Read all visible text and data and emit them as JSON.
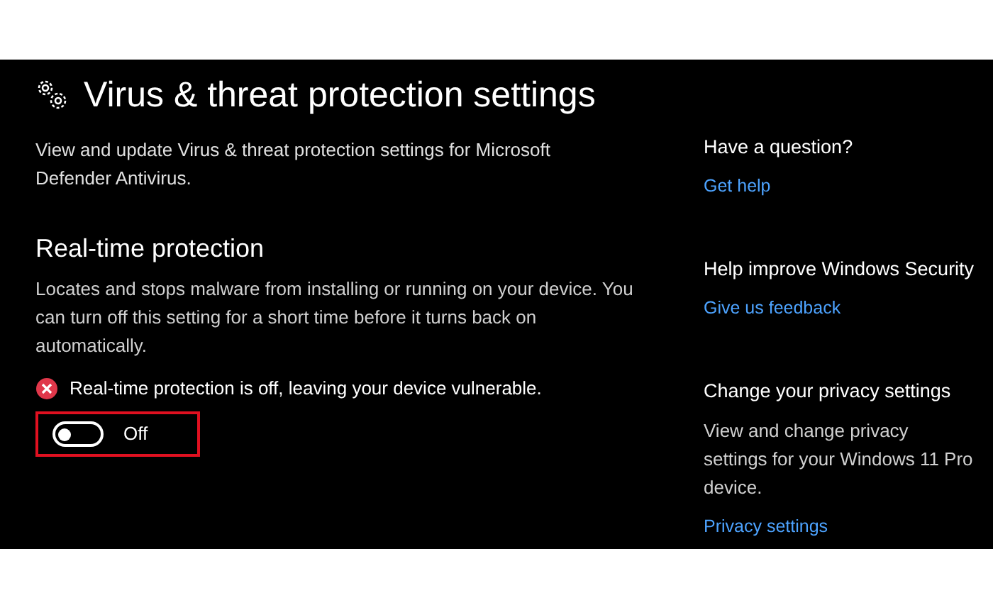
{
  "header": {
    "title": "Virus & threat protection settings",
    "description": "View and update Virus & threat protection settings for Microsoft Defender Antivirus."
  },
  "realtime": {
    "title": "Real-time protection",
    "description": "Locates and stops malware from installing or running on your device. You can turn off this setting for a short time before it turns back on automatically.",
    "warning": "Real-time protection is off, leaving your device vulnerable.",
    "toggle": {
      "on": false,
      "label": "Off",
      "highlighted": true
    }
  },
  "sidebar": [
    {
      "title": "Have a question?",
      "link": "Get help"
    },
    {
      "title": "Help improve Windows Security",
      "link": "Give us feedback"
    },
    {
      "title": "Change your privacy settings",
      "description": "View and change privacy settings for your Windows 11 Pro device.",
      "link": "Privacy settings"
    }
  ]
}
